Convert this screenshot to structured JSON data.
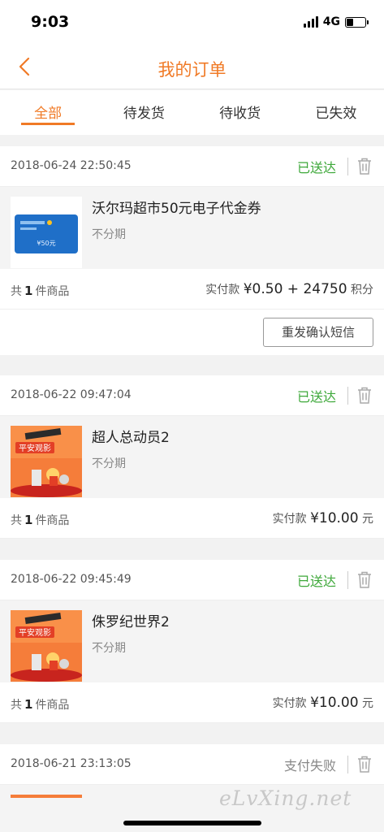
{
  "status_bar": {
    "time": "9:03",
    "network": "4G"
  },
  "header": {
    "title": "我的订单"
  },
  "tabs": [
    {
      "label": "全部",
      "active": true
    },
    {
      "label": "待发货",
      "active": false
    },
    {
      "label": "待收货",
      "active": false
    },
    {
      "label": "已失效",
      "active": false
    }
  ],
  "orders": [
    {
      "date": "2018-06-24 22:50:45",
      "status": "已送达",
      "item_name": "沃尔玛超市50元电子代金券",
      "installment": "不分期",
      "thumb_text": "¥50元",
      "count_prefix": "共",
      "count": "1",
      "count_suffix": "件商品",
      "pay_label": "实付款",
      "pay_amount": "¥0.50 + 24750",
      "pay_unit": "积分",
      "action": "重发确认短信"
    },
    {
      "date": "2018-06-22 09:47:04",
      "status": "已送达",
      "item_name": "超人总动员2",
      "installment": "不分期",
      "thumb_text": "平安观影",
      "count_prefix": "共",
      "count": "1",
      "count_suffix": "件商品",
      "pay_label": "实付款",
      "pay_amount": "¥10.00",
      "pay_unit": "元"
    },
    {
      "date": "2018-06-22 09:45:49",
      "status": "已送达",
      "item_name": "侏罗纪世界2",
      "installment": "不分期",
      "thumb_text": "平安观影",
      "count_prefix": "共",
      "count": "1",
      "count_suffix": "件商品",
      "pay_label": "实付款",
      "pay_amount": "¥10.00",
      "pay_unit": "元"
    },
    {
      "date": "2018-06-21 23:13:05",
      "status": "支付失败"
    }
  ],
  "watermark": "eLvXing.net",
  "colors": {
    "accent": "#f07a26",
    "delivered": "#3ea83a",
    "failed": "#888888"
  }
}
